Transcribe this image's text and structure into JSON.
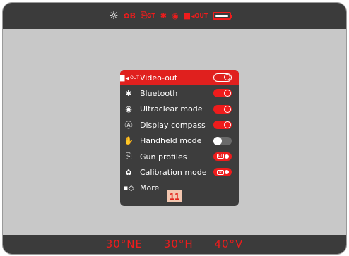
{
  "status_bar": {
    "icons": [
      "brightness-icon",
      "calibration-icon",
      "gun-profile-icon",
      "bluetooth-icon",
      "ultraclear-icon",
      "video-out-icon",
      "battery-icon"
    ],
    "calibration_tag": "B",
    "gun_profile_tag": "GT",
    "video_out_tag": "OUT"
  },
  "menu": {
    "items": [
      {
        "label": "Video-out",
        "icon": "video-out-icon",
        "icon_tag": "OUT",
        "control": "toggle",
        "state": "on",
        "active": true
      },
      {
        "label": "Bluetooth",
        "icon": "bluetooth-icon",
        "control": "toggle",
        "state": "on"
      },
      {
        "label": "Ultraclear mode",
        "icon": "eye-icon",
        "control": "toggle",
        "state": "on"
      },
      {
        "label": "Display compass",
        "icon": "compass-icon",
        "control": "toggle",
        "state": "on"
      },
      {
        "label": "Handheld mode",
        "icon": "hand-icon",
        "control": "toggle",
        "state": "off"
      },
      {
        "label": "Gun profiles",
        "icon": "gun-profile-icon",
        "control": "pill",
        "pill_tag": "GT"
      },
      {
        "label": "Calibration mode",
        "icon": "calibration-icon",
        "control": "pill",
        "pill_tag": "B"
      },
      {
        "label": "More",
        "icon": "more-icon",
        "control": "none"
      }
    ]
  },
  "readouts": {
    "heading": "30°NE",
    "tilt_h": "30°H",
    "tilt_v": "40°V"
  },
  "callout": "11",
  "colors": {
    "accent": "#ef1c1c",
    "panel": "#3d3d3d",
    "bars": "#3b3b3b",
    "background": "#c8c8c8",
    "callout_bg": "#f3c7b0"
  }
}
